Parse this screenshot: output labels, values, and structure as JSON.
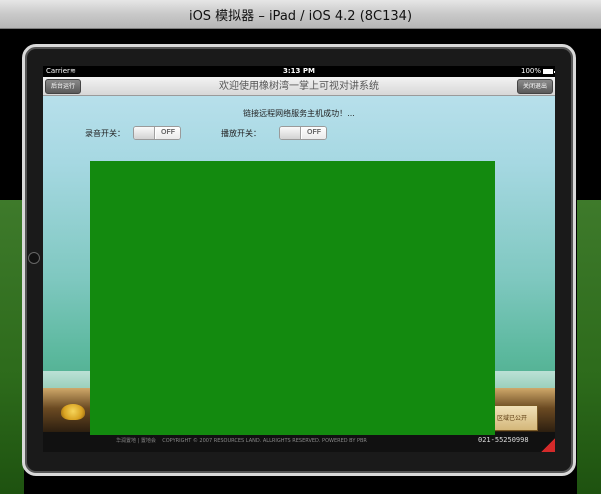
{
  "window": {
    "title": "iOS 模拟器 – iPad / iOS 4.2 (8C134)"
  },
  "statusbar": {
    "carrier": "Carrier",
    "time": "3:13 PM",
    "battery": "100%",
    "battery_level": 1.0
  },
  "navbar": {
    "title": "欢迎使用橡树湾一掌上可视对讲系统",
    "left_button": "后台运行",
    "right_button": "关闭退出"
  },
  "main": {
    "connect_message": "链接远程网络服务主机成功！...",
    "record_switch": {
      "label": "录音开关：",
      "state": "OFF"
    },
    "play_switch": {
      "label": "播放开关：",
      "state": "OFF"
    },
    "video_color": "#138a0f"
  },
  "footer": {
    "copyright": "COPYRIGHT © 2007 RESOURCES LAND. ALLRIGHTS RESERVED. POWERED BY PBR",
    "brand": "华润置地 | 置地会",
    "badge": "区域已公开",
    "phone": "021-55250998"
  }
}
